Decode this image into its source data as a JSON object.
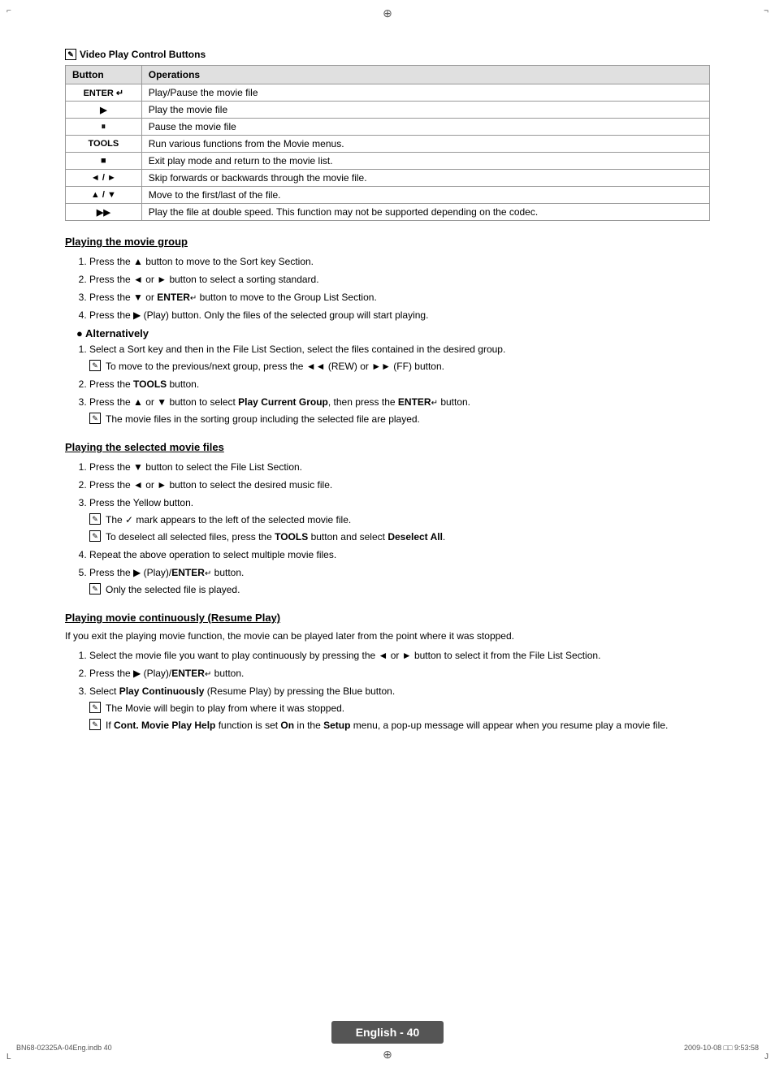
{
  "page": {
    "crosshair_top": "⊕",
    "crosshair_bottom": "⊕",
    "corner_tl": "⌐",
    "corner_tr": "¬",
    "corner_bl": "L",
    "corner_br": "J"
  },
  "table": {
    "title": "Video Play Control Buttons",
    "col1": "Button",
    "col2": "Operations",
    "rows": [
      {
        "button": "ENTER ↵",
        "operation": "Play/Pause the movie file"
      },
      {
        "button": "▶",
        "operation": "Play the movie file"
      },
      {
        "button": "⏸",
        "operation": "Pause the movie file"
      },
      {
        "button": "TOOLS",
        "operation": "Run various functions from the Movie menus."
      },
      {
        "button": "■",
        "operation": "Exit play mode and return to the movie list."
      },
      {
        "button": "◄ / ►",
        "operation": "Skip forwards or backwards through the movie file."
      },
      {
        "button": "▲ / ▼",
        "operation": "Move to the first/last of the file."
      },
      {
        "button": "▶▶",
        "operation": "Play the file at double speed. This function may not be supported depending on the codec."
      }
    ]
  },
  "section1": {
    "title": "Playing the movie group",
    "steps": [
      "Press the ▲ button to move to the Sort key Section.",
      "Press the ◄ or ► button to select a sorting standard.",
      "Press the ▼ or ENTER↵ button to move to the Group List Section.",
      "Press the ▶ (Play) button. Only the files of the selected group will start playing."
    ],
    "alternatively_label": "Alternatively",
    "alt_steps": [
      {
        "text": "Select a Sort key and then in the File List Section, select the files contained in the desired group.",
        "note": "To move to the previous/next group, press the ◄◄ (REW) or ►► (FF) button."
      },
      {
        "text": "Press the TOOLS button.",
        "note": null
      },
      {
        "text": "Press the ▲ or ▼ button to select Play Current Group, then press the ENTER↵ button.",
        "note": "The movie files in the sorting group including the selected file are played."
      }
    ]
  },
  "section2": {
    "title": "Playing the selected movie files",
    "steps": [
      {
        "text": "Press the ▼ button to select the File List Section.",
        "notes": []
      },
      {
        "text": "Press the ◄ or ► button to select the desired music file.",
        "notes": []
      },
      {
        "text": "Press the Yellow button.",
        "notes": [
          "The ✓ mark appears to the left of the selected movie file.",
          "To deselect all selected files, press the TOOLS button and select Deselect All."
        ]
      },
      {
        "text": "Repeat the above operation to select multiple movie files.",
        "notes": []
      },
      {
        "text": "Press the ▶ (Play)/ENTER↵ button.",
        "notes": [
          "Only the selected file is played."
        ]
      }
    ]
  },
  "section3": {
    "title": "Playing movie continuously (Resume Play)",
    "intro": "If you exit the playing movie function, the movie can be played later from the point where it was stopped.",
    "steps": [
      {
        "text": "Select the movie file you want to play continuously by pressing the ◄ or ► button to select it from the File List Section.",
        "notes": []
      },
      {
        "text": "Press the ▶ (Play)/ENTER↵ button.",
        "notes": []
      },
      {
        "text": "Select Play Continuously (Resume Play) by pressing the Blue button.",
        "notes": [
          "The Movie will begin to play from where it was stopped.",
          "If Cont. Movie Play Help function is set On in the Setup menu, a pop-up message will appear when you resume play a movie file."
        ]
      }
    ]
  },
  "footer": {
    "label": "English - 40",
    "left_text": "BN68-02325A-04Eng.indb   40",
    "right_text": "2009-10-08   □□ 9:53:58"
  }
}
